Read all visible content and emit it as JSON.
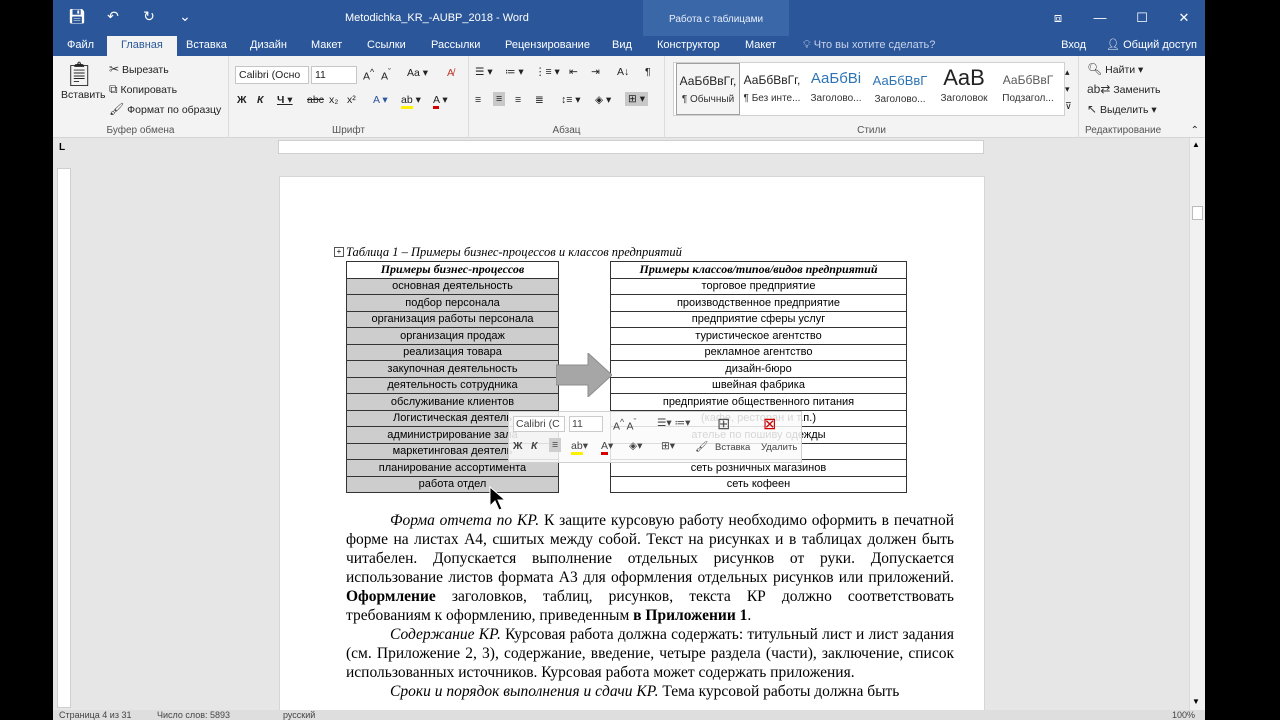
{
  "window": {
    "title": "Metodichka_KR_-AUBP_2018 - Word",
    "context_title": "Работа с таблицами",
    "controls": [
      "⧈",
      "—",
      "☐",
      "✕"
    ]
  },
  "tabs": {
    "items": [
      "Файл",
      "Главная",
      "Вставка",
      "Дизайн",
      "Макет",
      "Ссылки",
      "Рассылки",
      "Рецензирование",
      "Вид",
      "Конструктор",
      "Макет"
    ],
    "active": "Главная",
    "tell_me": "Что вы хотите сделать?",
    "signin": "Вход",
    "share": "Общий доступ"
  },
  "ribbon": {
    "clipboard": {
      "paste": "Вставить",
      "cut": "Вырезать",
      "copy": "Копировать",
      "format_painter": "Формат по образцу",
      "label": "Буфер обмена"
    },
    "font": {
      "font_name": "Calibri (Осно",
      "font_size": "11",
      "label": "Шрифт"
    },
    "paragraph": {
      "label": "Абзац"
    },
    "styles": {
      "items": [
        {
          "sample": "АаБбВвГг,",
          "name": "¶ Обычный"
        },
        {
          "sample": "АаБбВвГг,",
          "name": "¶ Без инте..."
        },
        {
          "sample": "АаБбВі",
          "name": "Заголово..."
        },
        {
          "sample": "АаБбВвГ",
          "name": "Заголово..."
        },
        {
          "sample": "AaB",
          "name": "Заголовок"
        },
        {
          "sample": "АаБбВвГ",
          "name": "Подзагол..."
        }
      ],
      "label": "Стили"
    },
    "editing": {
      "find": "Найти",
      "replace": "Заменить",
      "select": "Выделить",
      "label": "Редактирование"
    }
  },
  "document": {
    "caption": "Таблица 1 – Примеры бизнес-процессов и классов предприятий",
    "table": {
      "headers": [
        "Примеры бизнес-процессов",
        "Примеры классов/типов/видов предприятий"
      ],
      "rows": [
        [
          "основная деятельность",
          "торговое предприятие"
        ],
        [
          "подбор персонала",
          "производственное предприятие"
        ],
        [
          "организация работы персонала",
          "предприятие сферы услуг"
        ],
        [
          "организация продаж",
          "туристическое агентство"
        ],
        [
          "реализация товара",
          "рекламное агентство"
        ],
        [
          "закупочная деятельность",
          "дизайн-бюро"
        ],
        [
          "деятельность сотрудника",
          "швейная фабрика"
        ],
        [
          "обслуживание клиентов",
          "предприятие общественного питания"
        ],
        [
          "Логистическая деятель",
          "(кафе, ресторан и т.п.)"
        ],
        [
          "администрирование зала",
          "ателье по пошиву одежды"
        ],
        [
          "маркетинговая деятель",
          ""
        ],
        [
          "планирование ассортимента",
          "сеть розничных магазинов"
        ],
        [
          "работа отдел",
          "сеть кофеен"
        ]
      ]
    },
    "minibar": {
      "font": "Calibri (С",
      "size": "11",
      "insert": "Вставка",
      "delete": "Удалить"
    },
    "paragraphs": [
      {
        "lead": "Форма отчета по КР.",
        "text1": " К защите курсовую работу необходимо оформить в печатной форме на листах А4, сшитых между собой. Текст на рисунках и в таблицах должен быть читабелен. Допускается выполнение отдельных рисунков от руки. Допускается использование листов формата А3 для оформления отдельных рисунков или приложений. ",
        "bold1": "Оформление",
        "text2": " заголовков, таблиц, рисунков, текста КР должно соответствовать требованиям к оформлению, приведенным ",
        "bold2": "в Приложении 1",
        "text3": "."
      },
      {
        "lead": "Содержание КР.",
        "text1": " Курсовая работа должна содержать: титульный лист и лист задания (см. Приложение 2, 3), содержание, введение, четыре раздела (части), заключение, список использованных источников. Курсовая работа может содержать приложения."
      },
      {
        "lead": "Сроки и порядок выполнения и сдачи КР.",
        "text1": " Тема курсовой работы должна быть"
      }
    ]
  },
  "statusbar": {
    "page": "Страница 4 из 31",
    "words": "Число слов: 5893",
    "lang": "русский",
    "zoom": "100%"
  }
}
